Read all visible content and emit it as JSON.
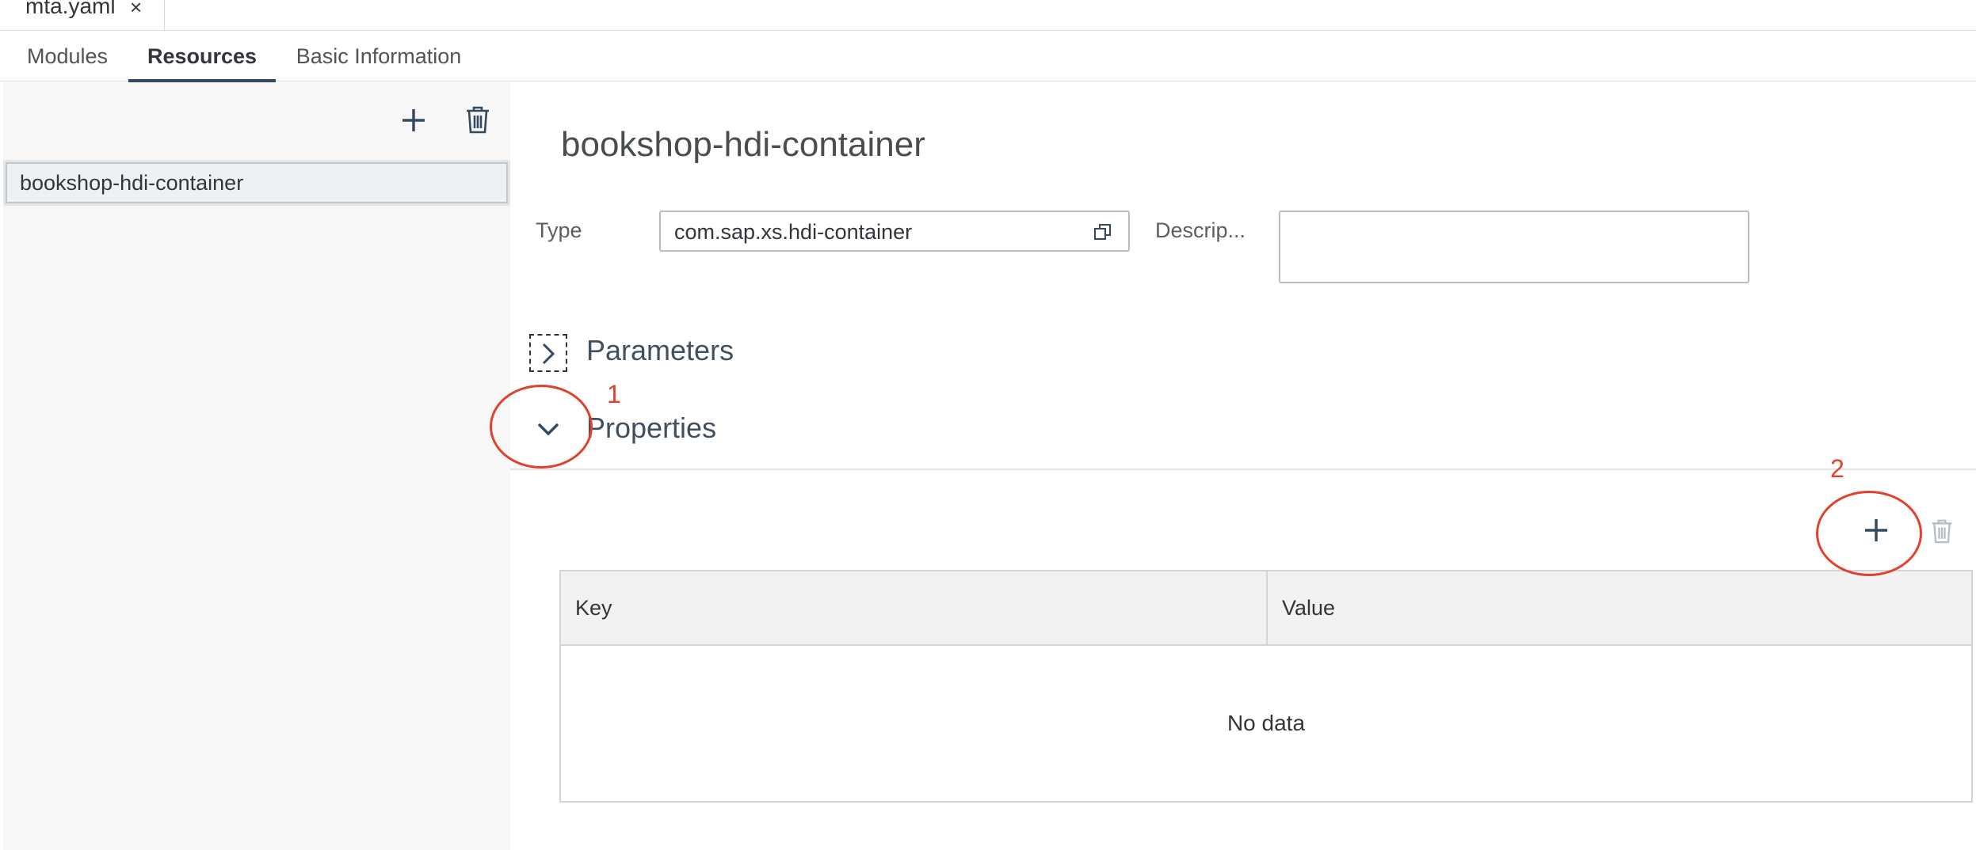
{
  "file_tab": {
    "name": "mta.yaml",
    "close": "×"
  },
  "editor_tabs": [
    {
      "label": "Modules"
    },
    {
      "label": "Resources"
    },
    {
      "label": "Basic Information"
    }
  ],
  "sidebar": {
    "add_icon": "plus-icon",
    "delete_icon": "trash-icon",
    "items": [
      {
        "label": "bookshop-hdi-container"
      }
    ]
  },
  "resource": {
    "title": "bookshop-hdi-container",
    "type_label": "Type",
    "type_value": "com.sap.xs.hdi-container",
    "description_label": "Descrip...",
    "description_value": ""
  },
  "sections": {
    "parameters": {
      "label": "Parameters",
      "expanded": false
    },
    "properties": {
      "label": "Properties",
      "expanded": true
    }
  },
  "properties_table": {
    "columns": [
      "Key",
      "Value"
    ],
    "rows": [],
    "empty_text": "No data"
  },
  "annotations": [
    {
      "label": "1"
    },
    {
      "label": "2"
    }
  ],
  "colors": {
    "accent": "#354a5f",
    "annotation": "#e2412c",
    "sidebar_bg": "#f7f7f7"
  }
}
